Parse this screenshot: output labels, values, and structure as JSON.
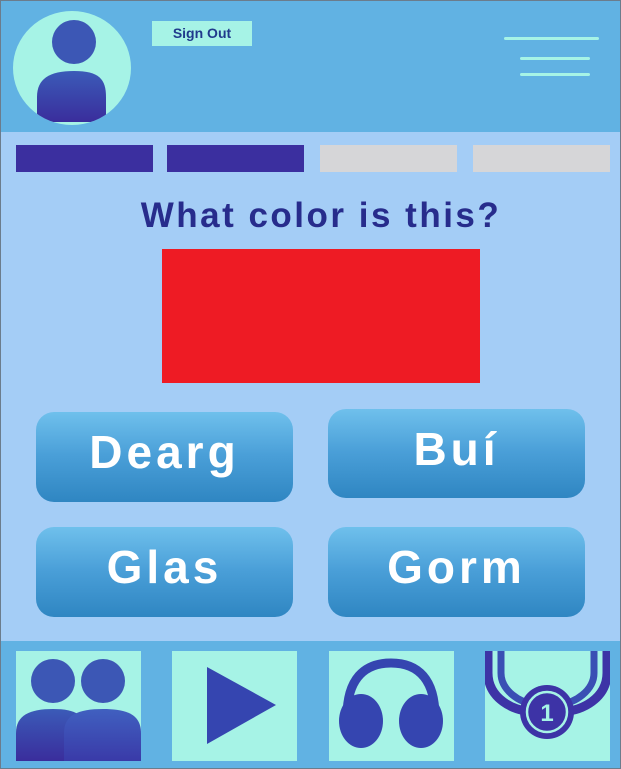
{
  "header": {
    "avatar_icon": "user-avatar-icon",
    "signout_label": "Sign Out",
    "menu_icon": "hamburger-menu-icon"
  },
  "progress": {
    "total_steps": 4,
    "completed_steps": 2,
    "done_color": "#3b2f9f",
    "todo_color": "#d6d6d8"
  },
  "quiz": {
    "question": "What color is this?",
    "swatch_color": "#ee1b24",
    "answers": [
      "Dearg",
      "Buí",
      "Glas",
      "Gorm"
    ]
  },
  "nav": {
    "items": [
      {
        "icon": "friends-icon"
      },
      {
        "icon": "play-icon"
      },
      {
        "icon": "headphones-icon"
      },
      {
        "icon": "medal-icon",
        "badge": "1"
      }
    ]
  },
  "colors": {
    "header_bg": "#61b2e3",
    "page_bg": "#a4cdf6",
    "tile_bg": "#a6f3e6",
    "accent_dark": "#272c8c"
  }
}
